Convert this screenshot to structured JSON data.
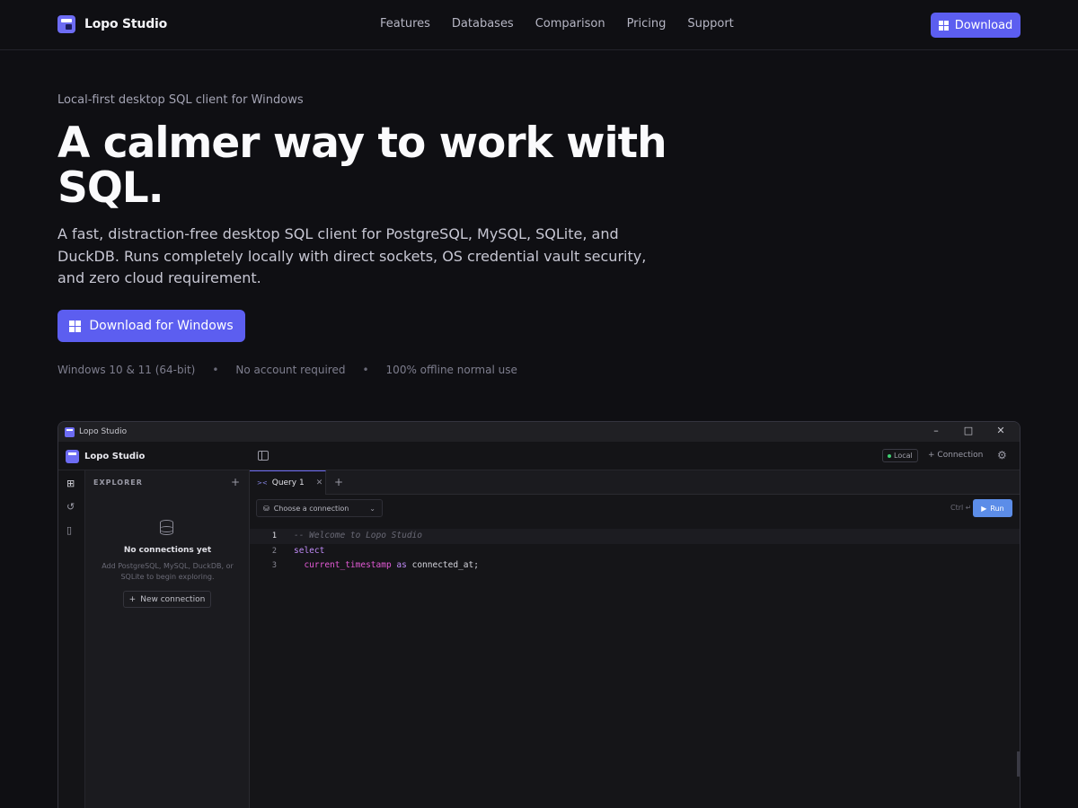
{
  "nav": {
    "brand": "Lopo Studio",
    "links": [
      "Features",
      "Databases",
      "Comparison",
      "Pricing",
      "Support"
    ],
    "download_label": "Download"
  },
  "hero": {
    "eyebrow": "Local-first desktop SQL client for Windows",
    "title": "A calmer way to work with SQL.",
    "description": "A fast, distraction-free desktop SQL client for PostgreSQL, MySQL, SQLite, and DuckDB. Runs completely locally with direct sockets, OS credential vault security, and zero cloud requirement.",
    "download_label": "Download for Windows",
    "meta": [
      "Windows 10 & 11 (64-bit)",
      "No account required",
      "100% offline normal use"
    ]
  },
  "app": {
    "window_title": "Lopo Studio",
    "brand": "Lopo Studio",
    "local_badge": "Local",
    "connection_label": "Connection",
    "explorer": {
      "heading": "EXPLORER",
      "empty_title": "No connections yet",
      "empty_desc": "Add PostgreSQL, MySQL, DuckDB, or SQLite to begin exploring.",
      "new_connection_label": "New connection"
    },
    "tab_label": "Query 1",
    "connection_select": "Choose a connection",
    "shortcut": "Ctrl ↵",
    "run_label": "Run",
    "code": {
      "line1": "-- Welcome to Lopo Studio",
      "line2_kw": "select",
      "line3_fn": "current_timestamp",
      "line3_kw": "as",
      "line3_id": "connected_at;"
    }
  },
  "icons": {
    "logo": "lopo-logo-icon",
    "windows": "windows-icon",
    "minimize": "minimize-icon",
    "maximize": "maximize-icon",
    "close": "close-icon",
    "panel": "sidebar-toggle-icon",
    "gear": "gear-icon",
    "database": "database-icon"
  },
  "colors": {
    "accent": "#5c5ef0",
    "run": "#5c8de8",
    "background": "#0f0f13"
  }
}
